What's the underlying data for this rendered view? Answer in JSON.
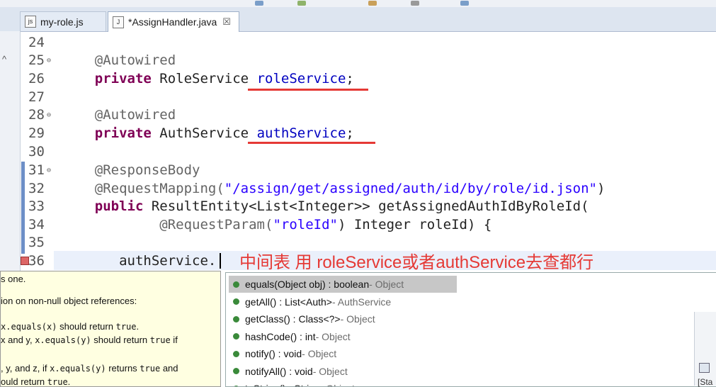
{
  "tabs": [
    {
      "label": "my-role.js",
      "icon": "js-file-icon"
    },
    {
      "label": "*AssignHandler.java",
      "icon": "java-file-icon",
      "close": "☒"
    }
  ],
  "code_lines": [
    {
      "num": "24"
    },
    {
      "num": "25",
      "ann": "@Autowired"
    },
    {
      "num": "26",
      "kw": "private",
      "type": " RoleService ",
      "field": "roleService",
      "tail": ";"
    },
    {
      "num": "27"
    },
    {
      "num": "28",
      "ann": "@Autowired"
    },
    {
      "num": "29",
      "kw": "private",
      "type": " AuthService ",
      "field": "authService",
      "tail": ";"
    },
    {
      "num": "30"
    },
    {
      "num": "31",
      "ann": "@ResponseBody"
    },
    {
      "num": "32",
      "ann": "@RequestMapping(",
      "str": "\"/assign/get/assigned/auth/id/by/role/id.json\"",
      "tail": ")"
    },
    {
      "num": "33",
      "kw": "public",
      "rest": " ResultEntity<List<Integer>> getAssignedAuthIdByRoleId("
    },
    {
      "num": "34",
      "ann": "@RequestParam(",
      "str": "\"roleId\"",
      "rest": ") Integer roleId) {"
    },
    {
      "num": "35"
    },
    {
      "num": "36",
      "rest": "authService."
    }
  ],
  "annotation_note": "中间表  用 roleService或者authService去查都行",
  "javadoc": [
    {
      "plain": "s one."
    },
    {
      "plain": "ion on non-null object references:"
    },
    {
      "code": "x.equals(x)",
      "plain2": " should return ",
      "code2": "true",
      "plain3": "."
    },
    {
      "plain": "x and y, ",
      "code": "x.equals(y)",
      "plain2": " should return ",
      "code2": "true",
      "plain3": " if"
    },
    {
      "plain": ", y, and z, if ",
      "code": "x.equals(y)",
      "plain2": " returns ",
      "code2": "true",
      "plain3": " and"
    },
    {
      "plain": "ould return ",
      "code": "true",
      "plain3": "."
    }
  ],
  "completions": [
    {
      "sig": "equals(Object obj) : boolean",
      "owner": " - Object"
    },
    {
      "sig": "getAll() : List<Auth>",
      "owner": " - AuthService"
    },
    {
      "sig": "getClass() : Class<?>",
      "owner": " - Object"
    },
    {
      "sig": "hashCode() : int",
      "owner": " - Object"
    },
    {
      "sig": "notify() : void",
      "owner": " - Object"
    },
    {
      "sig": "notifyAll() : void",
      "owner": " - Object"
    },
    {
      "sig": "toString() : String",
      "owner": " - Object"
    }
  ],
  "right_panel_text": "[Sta"
}
